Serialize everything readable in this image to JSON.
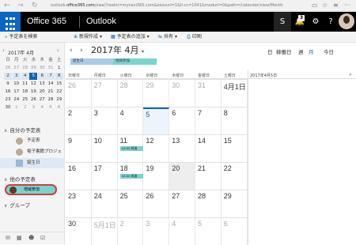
{
  "browser": {
    "url_prefix": "outlook.",
    "url_host": "office365.com",
    "url_rest": "/owa/?realm=mynavi365.com&exsvurl=1&ll-cc=1041&modurl=0&path=/calendar/view/Month",
    "back": "←",
    "forward": "→",
    "refresh": "↻"
  },
  "suite": {
    "brand": "Office 365",
    "app": "Outlook",
    "skype_badge": "",
    "notif_badge": "3",
    "settings": "⚙",
    "help": "?"
  },
  "toolbar": {
    "search": "予定表を検索",
    "new": "新規作成",
    "new_caret": "▾",
    "add_calendar": "予定表の追加",
    "add_caret": "▾",
    "share": "共有",
    "share_caret": "▾",
    "print": "印刷"
  },
  "mini_calendar": {
    "title": "2017年 4月",
    "weekdays": [
      "日",
      "月",
      "火",
      "水",
      "木",
      "金",
      "土"
    ],
    "weeks": [
      [
        {
          "d": "26",
          "o": true
        },
        {
          "d": "27",
          "o": true
        },
        {
          "d": "28",
          "o": true
        },
        {
          "d": "29",
          "o": true
        },
        {
          "d": "30",
          "o": true
        },
        {
          "d": "31",
          "o": true
        },
        {
          "d": "1"
        }
      ],
      [
        {
          "d": "2"
        },
        {
          "d": "3"
        },
        {
          "d": "4"
        },
        {
          "d": "5",
          "sel": true
        },
        {
          "d": "6"
        },
        {
          "d": "7"
        },
        {
          "d": "8"
        }
      ],
      [
        {
          "d": "9"
        },
        {
          "d": "10"
        },
        {
          "d": "11"
        },
        {
          "d": "12"
        },
        {
          "d": "13"
        },
        {
          "d": "14"
        },
        {
          "d": "15"
        }
      ],
      [
        {
          "d": "16"
        },
        {
          "d": "17"
        },
        {
          "d": "18"
        },
        {
          "d": "19"
        },
        {
          "d": "20"
        },
        {
          "d": "21"
        },
        {
          "d": "22"
        }
      ],
      [
        {
          "d": "23"
        },
        {
          "d": "24"
        },
        {
          "d": "25"
        },
        {
          "d": "26"
        },
        {
          "d": "27"
        },
        {
          "d": "28"
        },
        {
          "d": "29"
        }
      ],
      [
        {
          "d": "30"
        },
        {
          "d": "1",
          "o": true
        },
        {
          "d": "2",
          "o": true
        },
        {
          "d": "3",
          "o": true
        },
        {
          "d": "4",
          "o": true
        },
        {
          "d": "5",
          "o": true
        },
        {
          "d": "6",
          "o": true
        }
      ]
    ]
  },
  "sidebar": {
    "my_calendars": "自分の予定表",
    "items": [
      {
        "label": "予定表",
        "kind": "avatar"
      },
      {
        "label": "電子書籍プロジェクト",
        "kind": "avatar"
      },
      {
        "label": "誕生日",
        "kind": "square"
      }
    ],
    "other_calendars": "他の予定表",
    "other_item": "地域参加",
    "groups": "グループ"
  },
  "header": {
    "title": "2017年 4月",
    "title_caret": "▾",
    "views": {
      "day": "日",
      "work_week": "稼働日",
      "week": "週",
      "month": "月"
    },
    "today": "今日",
    "bars": [
      {
        "label": "誕生日",
        "color": "#a9cbe8"
      },
      {
        "label": "地域参加",
        "color": "#79d4cd"
      }
    ]
  },
  "days": [
    "日曜日",
    "月曜日",
    "火曜日",
    "水曜日",
    "木曜日",
    "金曜日",
    "土曜日"
  ],
  "side_date": "2017年4月5日",
  "side_more": "»",
  "month": [
    [
      {
        "d": "26",
        "o": true
      },
      {
        "d": "27",
        "o": true
      },
      {
        "d": "28",
        "o": true
      },
      {
        "d": "29",
        "o": true
      },
      {
        "d": "30",
        "o": true
      },
      {
        "d": "31",
        "o": true
      },
      {
        "d": "4月1日"
      }
    ],
    [
      {
        "d": "2"
      },
      {
        "d": "3"
      },
      {
        "d": "4"
      },
      {
        "d": "5",
        "today": true
      },
      {
        "d": "6"
      },
      {
        "d": "7"
      },
      {
        "d": "8"
      }
    ],
    [
      {
        "d": "9"
      },
      {
        "d": "10"
      },
      {
        "d": "11",
        "evt": "10:00 昇進"
      },
      {
        "d": "12"
      },
      {
        "d": "13"
      },
      {
        "d": "14"
      },
      {
        "d": "15"
      }
    ],
    [
      {
        "d": "16"
      },
      {
        "d": "17"
      },
      {
        "d": "18",
        "evt": "10:00 昇進"
      },
      {
        "d": "19"
      },
      {
        "d": "20",
        "gray": true
      },
      {
        "d": "21"
      },
      {
        "d": "22"
      }
    ],
    [
      {
        "d": "23"
      },
      {
        "d": "24"
      },
      {
        "d": "25"
      },
      {
        "d": "26"
      },
      {
        "d": "27"
      },
      {
        "d": "28"
      },
      {
        "d": "29"
      }
    ],
    [
      {
        "d": "30"
      },
      {
        "d": "5月1日",
        "o": true
      },
      {
        "d": "2",
        "o": true
      },
      {
        "d": "3",
        "o": true
      },
      {
        "d": "4",
        "o": true
      },
      {
        "d": "5",
        "o": true
      },
      {
        "d": "6",
        "o": true
      }
    ]
  ],
  "colors": {
    "accent": "#0a66c0",
    "event": "#79d4cd",
    "ring": "#d23c3c"
  }
}
